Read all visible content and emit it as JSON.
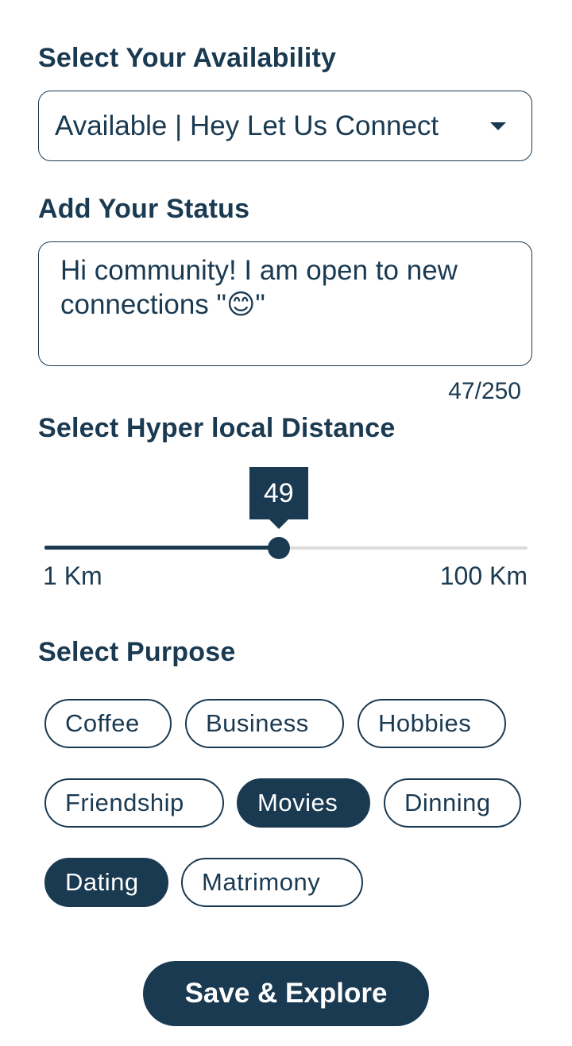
{
  "availability": {
    "title": "Select Your Availability",
    "selected": "Available | Hey Let Us Connect"
  },
  "status": {
    "title": "Add Your Status",
    "text": "Hi community! I am open to new connections \"😊\"",
    "counter": "47/250"
  },
  "distance": {
    "title": "Select Hyper local Distance",
    "value": 49,
    "value_label": "49",
    "min": 1,
    "max": 100,
    "min_label": "1 Km",
    "max_label": "100 Km"
  },
  "purpose": {
    "title": "Select Purpose",
    "chips": [
      {
        "label": "Coffee",
        "selected": false
      },
      {
        "label": "Business",
        "selected": false
      },
      {
        "label": "Hobbies",
        "selected": false
      },
      {
        "label": "Friendship",
        "selected": false
      },
      {
        "label": "Movies",
        "selected": true
      },
      {
        "label": "Dinning",
        "selected": false
      },
      {
        "label": "Dating",
        "selected": true
      },
      {
        "label": "Matrimony",
        "selected": false
      }
    ]
  },
  "actions": {
    "save_label": "Save & Explore"
  },
  "colors": {
    "primary": "#1a3a52",
    "track": "#dcdcdc",
    "background": "#ffffff"
  }
}
